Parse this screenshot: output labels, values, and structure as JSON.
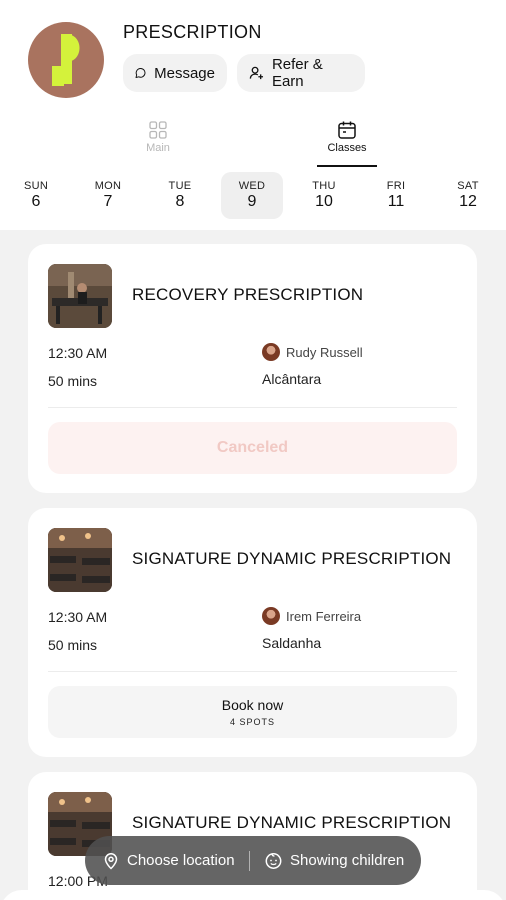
{
  "header": {
    "brand": "PRESCRIPTION",
    "message_label": "Message",
    "refer_label": "Refer & Earn",
    "colors": {
      "logo_bg": "#a9735f",
      "logo_mark": "#d4f23b"
    }
  },
  "tabs": [
    {
      "label": "Main",
      "icon": "grid-icon",
      "active": false
    },
    {
      "label": "Classes",
      "icon": "calendar-icon",
      "active": true
    }
  ],
  "days": [
    {
      "name": "SUN",
      "date": "6"
    },
    {
      "name": "MON",
      "date": "7"
    },
    {
      "name": "TUE",
      "date": "8"
    },
    {
      "name": "WED",
      "date": "9",
      "selected": true
    },
    {
      "name": "THU",
      "date": "10"
    },
    {
      "name": "FRI",
      "date": "11"
    },
    {
      "name": "SAT",
      "date": "12"
    }
  ],
  "classes": [
    {
      "title": "RECOVERY PRESCRIPTION",
      "time": "12:30 AM",
      "duration": "50 mins",
      "instructor": "Rudy Russell",
      "location": "Alcântara",
      "action": "Canceled"
    },
    {
      "title": "SIGNATURE DYNAMIC PRESCRIPTION",
      "time": "12:30 AM",
      "duration": "50 mins",
      "instructor": "Irem Ferreira",
      "location": "Saldanha",
      "action": "Book now",
      "spots": "4 SPOTS"
    },
    {
      "title": "SIGNATURE DYNAMIC PRESCRIPTION",
      "time": "12:00 PM"
    }
  ],
  "bottom_bar": {
    "location_label": "Choose location",
    "children_label": "Showing children"
  }
}
